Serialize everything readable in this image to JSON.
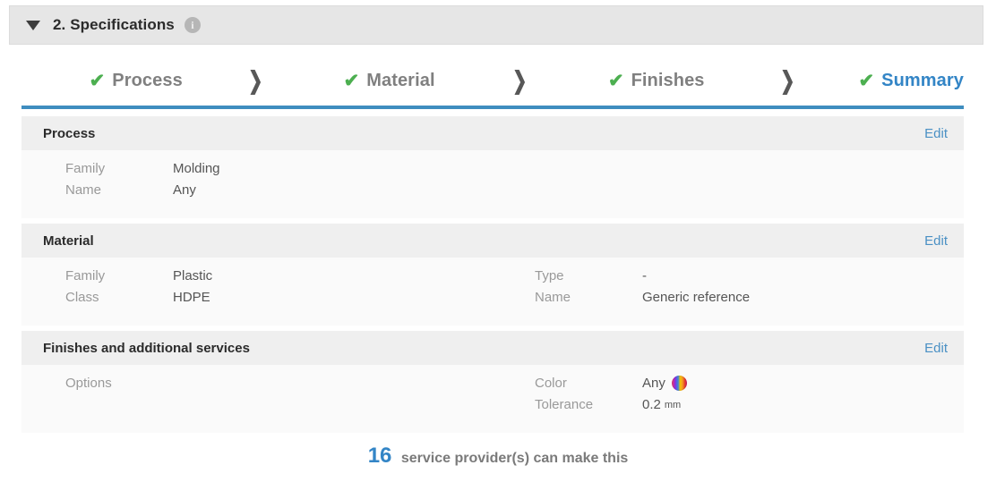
{
  "panel": {
    "title": "2. Specifications",
    "caret_icon": "triangle-down-icon",
    "info_icon": "info-icon",
    "info_glyph": "i"
  },
  "steps": {
    "check_glyph": "✔",
    "separator_glyph": "❯",
    "items": [
      {
        "label": "Process",
        "active": false
      },
      {
        "label": "Material",
        "active": false
      },
      {
        "label": "Finishes",
        "active": false
      },
      {
        "label": "Summary",
        "active": true
      }
    ]
  },
  "sections": [
    {
      "title": "Process",
      "edit_label": "Edit",
      "left": [
        {
          "key": "Family",
          "value": "Molding"
        },
        {
          "key": "Name",
          "value": "Any"
        }
      ],
      "right": []
    },
    {
      "title": "Material",
      "edit_label": "Edit",
      "left": [
        {
          "key": "Family",
          "value": "Plastic"
        },
        {
          "key": "Class",
          "value": "HDPE"
        }
      ],
      "right": [
        {
          "key": "Type",
          "value": "-"
        },
        {
          "key": "Name",
          "value": "Generic reference"
        }
      ]
    },
    {
      "title": "Finishes and additional services",
      "edit_label": "Edit",
      "left": [
        {
          "key": "Options",
          "value": ""
        }
      ],
      "right": [
        {
          "key": "Color",
          "value": "Any",
          "swatch": "rainbow-color-swatch"
        },
        {
          "key": "Tolerance",
          "value": "0.2",
          "unit": "mm"
        }
      ]
    }
  ],
  "footer": {
    "count": "16",
    "text": "service provider(s) can make this"
  },
  "colors": {
    "accent_blue": "#3385c6",
    "rule_blue": "#3f8dbf",
    "link_blue": "#4a90c4",
    "check_green": "#4caf50",
    "header_gray": "#e6e6e6",
    "section_head_gray": "#efefef",
    "section_body_gray": "#fafafa"
  }
}
